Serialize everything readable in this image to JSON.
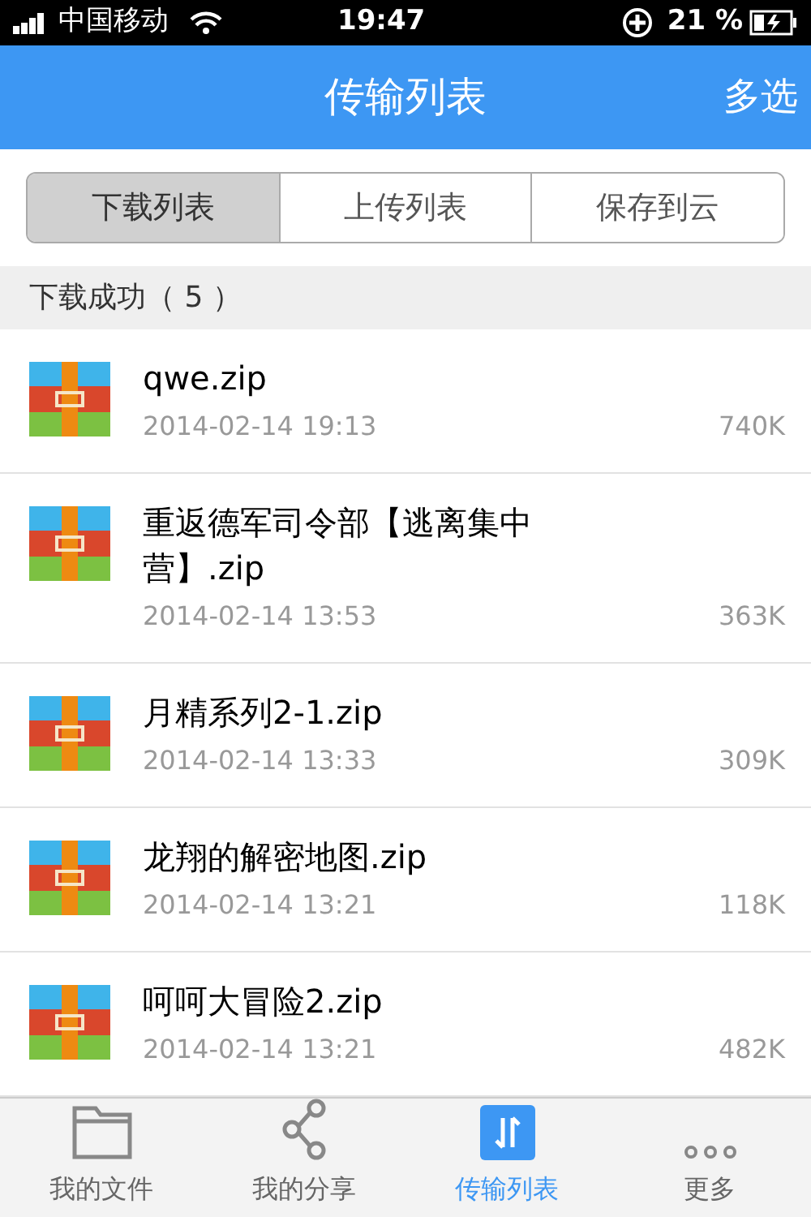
{
  "status_bar": {
    "carrier": "中国移动",
    "time": "19:47",
    "battery": "21 %"
  },
  "nav_bar": {
    "title": "传输列表",
    "action": "多选"
  },
  "segments": [
    {
      "label": "下载列表",
      "selected": true
    },
    {
      "label": "上传列表",
      "selected": false
    },
    {
      "label": "保存到云",
      "selected": false
    }
  ],
  "section": {
    "title": "下载成功（ 5 ）"
  },
  "files": [
    {
      "name": "qwe.zip",
      "date": "2014-02-14 19:13",
      "size": "740K"
    },
    {
      "name": "重返德军司令部【逃离集中营】.zip",
      "date": "2014-02-14 13:53",
      "size": "363K"
    },
    {
      "name": "月精系列2-1.zip",
      "date": "2014-02-14 13:33",
      "size": "309K"
    },
    {
      "name": "龙翔的解密地图.zip",
      "date": "2014-02-14 13:21",
      "size": "118K"
    },
    {
      "name": "呵呵大冒险2.zip",
      "date": "2014-02-14 13:21",
      "size": "482K"
    }
  ],
  "tab_bar": [
    {
      "kind": "folder",
      "label": "我的文件",
      "selected": false
    },
    {
      "kind": "share",
      "label": "我的分享",
      "selected": false
    },
    {
      "kind": "transfer",
      "label": "传输列表",
      "selected": true
    },
    {
      "kind": "more",
      "label": "更多",
      "selected": false
    }
  ]
}
